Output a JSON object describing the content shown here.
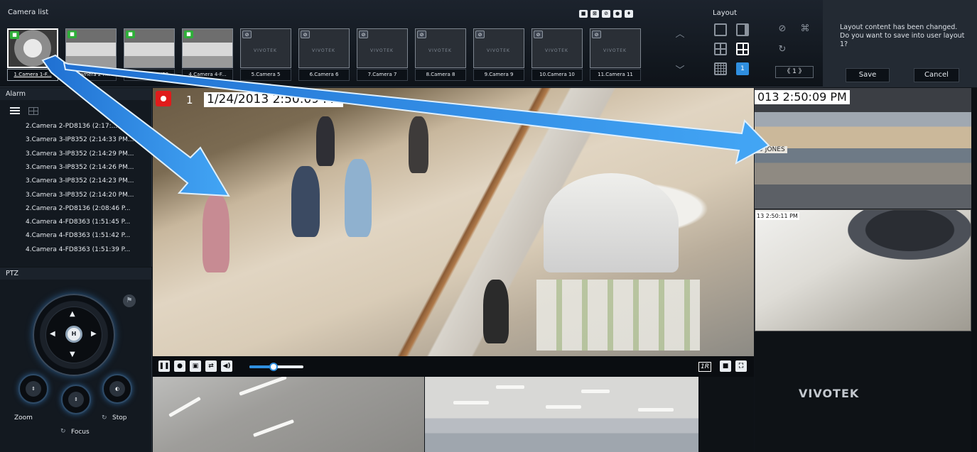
{
  "camera_list": {
    "title": "Camera list",
    "cameras": [
      {
        "label": "1.Camera 1-F...",
        "status": "live",
        "selected": true
      },
      {
        "label": "2.Camera 2-P...",
        "status": "live",
        "selected": false
      },
      {
        "label": "3.Camera 3-IP8",
        "status": "live",
        "selected": false
      },
      {
        "label": "4.Camera 4-F...",
        "status": "live",
        "selected": false
      },
      {
        "label": "5.Camera 5",
        "status": "offline",
        "selected": false
      },
      {
        "label": "6.Camera 6",
        "status": "offline",
        "selected": false
      },
      {
        "label": "7.Camera 7",
        "status": "offline",
        "selected": false
      },
      {
        "label": "8.Camera 8",
        "status": "offline",
        "selected": false
      },
      {
        "label": "9.Camera 9",
        "status": "offline",
        "selected": false
      },
      {
        "label": "10.Camera 10",
        "status": "offline",
        "selected": false
      },
      {
        "label": "11.Camera 11",
        "status": "offline",
        "selected": false
      }
    ],
    "thumb_brand": "VIVOTEK",
    "header_icons": [
      "camera-live-icon",
      "camera-lock-icon",
      "disabled-icon",
      "settings-icon",
      "pin-icon"
    ]
  },
  "layout": {
    "title": "Layout",
    "current_page": "1",
    "active_layout_number": "1"
  },
  "save_prompt": {
    "message": "Layout content has been changed. Do you want to save into user layout 1?",
    "save_label": "Save",
    "cancel_label": "Cancel"
  },
  "alarm": {
    "title": "Alarm",
    "items": [
      "2.Camera 2-PD8136 (2:17:...",
      "3.Camera 3-IP8352 (2:14:33 PM...",
      "3.Camera 3-IP8352 (2:14:29 PM...",
      "3.Camera 3-IP8352 (2:14:26 PM...",
      "3.Camera 3-IP8352 (2:14:23 PM...",
      "3.Camera 3-IP8352 (2:14:20 PM...",
      "2.Camera 2-PD8136 (2:08:46 P...",
      "4.Camera 4-FD8363 (1:51:45 P...",
      "4.Camera 4-FD8363 (1:51:42 P...",
      "4.Camera 4-FD8363 (1:51:39 P..."
    ]
  },
  "ptz": {
    "title": "PTZ",
    "home_label": "H",
    "zoom_label": "Zoom",
    "focus_label": "Focus",
    "stop_label": "Stop"
  },
  "main_view": {
    "channel": "1",
    "timestamp": "1/24/2013 2:50:09 PM",
    "speed_label": "1R",
    "volume_level": 0.45
  },
  "side_views": {
    "top_timestamp": "013 2:50:09 PM",
    "top_sign": "D JONES",
    "mid_timestamp": "13 2:50:11 PM",
    "brand": "VIVOTEK"
  },
  "colors": {
    "accent": "#2f8fe0",
    "live": "#2fae3a",
    "record": "#e01b1b"
  }
}
